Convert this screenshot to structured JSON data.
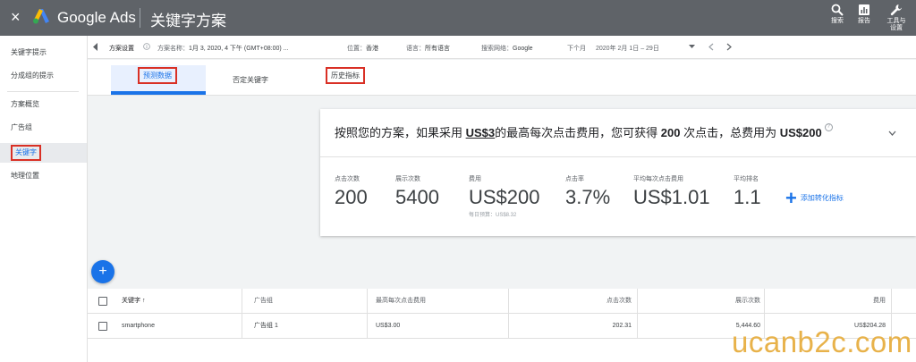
{
  "topbar": {
    "close_glyph": "×",
    "brand": "Google Ads",
    "page_title": "关键字方案",
    "tools": [
      {
        "label": "搜索",
        "icon": "search-icon"
      },
      {
        "label": "报告",
        "icon": "bar-chart-icon"
      },
      {
        "label": "工具与\n设置",
        "icon": "wrench-icon"
      }
    ]
  },
  "sidebar": {
    "items": [
      {
        "label": "关键字提示"
      },
      {
        "label": "分成组的提示"
      },
      {
        "label": "方案概览"
      },
      {
        "label": "广告组"
      },
      {
        "label": "关键字"
      },
      {
        "label": "地理位置"
      }
    ]
  },
  "filters": {
    "plan_settings": "方案设置",
    "plan_name_label": "方案名称：",
    "plan_name": "1月 3, 2020, 4 下午 (GMT+08:00) ...",
    "location_label": "位置：",
    "location": "香港",
    "language_label": "语言：",
    "language": "所有语言",
    "network_label": "搜索网络：",
    "network": "Google",
    "period_label": "下个月",
    "period": "2020年 2月 1日 – 29日"
  },
  "tabs": [
    {
      "label": "预测数据"
    },
    {
      "label": "否定关键字"
    },
    {
      "label": "历史指标"
    }
  ],
  "forecast": {
    "headline_pre": "按照您的方案，如果采用 ",
    "bid": "US$3",
    "headline_mid": "的最高每次点击费用，您可获得 ",
    "clicks_bold": "200",
    "headline_mid2": " 次点击，总费用为 ",
    "cost_bold": "US$200",
    "metrics": [
      {
        "label": "点击次数",
        "value": "200",
        "sub": ""
      },
      {
        "label": "展示次数",
        "value": "5400",
        "sub": ""
      },
      {
        "label": "费用",
        "value": "US$200",
        "sub": "每日预算：US$8.32"
      },
      {
        "label": "点击率",
        "value": "3.7%",
        "sub": ""
      },
      {
        "label": "平均每次点击费用",
        "value": "US$1.01",
        "sub": ""
      },
      {
        "label": "平均排名",
        "value": "1.1",
        "sub": ""
      }
    ],
    "add_conversion": "添加转化指标"
  },
  "table": {
    "headers": {
      "keyword": "关键字 ↑",
      "ad_group": "广告组",
      "max_cpc": "最高每次点击费用",
      "clicks": "点击次数",
      "impressions": "展示次数",
      "cost": "费用"
    },
    "rows": [
      {
        "keyword": "smartphone",
        "ad_group": "广告组 1",
        "max_cpc": "US$3.00",
        "clicks": "202.31",
        "impressions": "5,444.60",
        "cost": "US$204.28"
      }
    ]
  },
  "watermark": "ucanb2c.com",
  "colors": {
    "topbar": "#5f6368",
    "accent": "#1a73e8",
    "highlight_box": "#d93025",
    "watermark": "#e8b24a"
  }
}
